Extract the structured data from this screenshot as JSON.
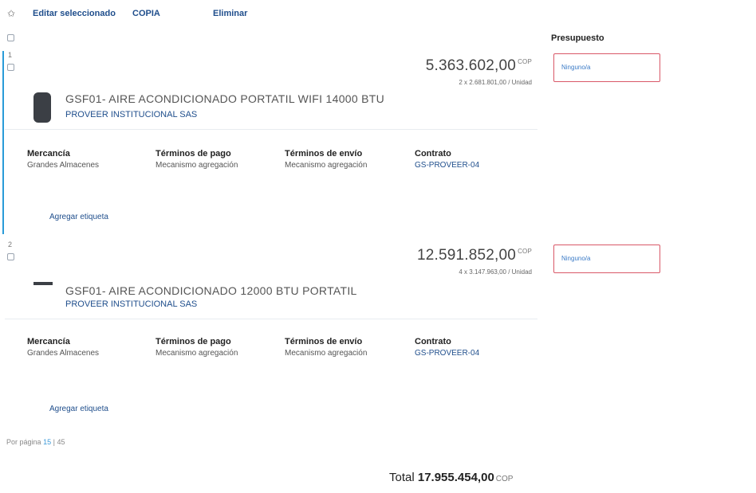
{
  "toolbar": {
    "edit_label": "Editar seleccionado",
    "copy_label": "COPIA",
    "delete_label": "Eliminar"
  },
  "budget_header": "Presupuesto",
  "items": [
    {
      "number": "1",
      "price": "5.363.602,00",
      "currency": "COP",
      "unit_detail": "2 x 2.681.801,00 / Unidad",
      "product_name": "GSF01- AIRE ACONDICIONADO PORTATIL WIFI 14000 BTU",
      "supplier": "PROVEER INSTITUCIONAL SAS",
      "merchandise_label": "Mercancía",
      "merchandise_value": "Grandes Almacenes",
      "payment_label": "Términos de pago",
      "payment_value": "Mecanismo agregación",
      "shipping_label": "Términos de envío",
      "shipping_value": "Mecanismo agregación",
      "contract_label": "Contrato",
      "contract_value": "GS-PROVEER-04",
      "tag_link": "Agregar etiqueta",
      "budget_value": "Ninguno/a"
    },
    {
      "number": "2",
      "price": "12.591.852,00",
      "currency": "COP",
      "unit_detail": "4 x 3.147.963,00 / Unidad",
      "product_name": "GSF01- AIRE ACONDICIONADO 12000 BTU PORTATIL",
      "supplier": "PROVEER INSTITUCIONAL SAS",
      "merchandise_label": "Mercancía",
      "merchandise_value": "Grandes Almacenes",
      "payment_label": "Términos de pago",
      "payment_value": "Mecanismo agregación",
      "shipping_label": "Términos de envío",
      "shipping_value": "Mecanismo agregación",
      "contract_label": "Contrato",
      "contract_value": "GS-PROVEER-04",
      "tag_link": "Agregar etiqueta",
      "budget_value": "Ninguno/a"
    }
  ],
  "pagination": {
    "label": "Por página",
    "current": "15",
    "separator": "|",
    "other": "45"
  },
  "total": {
    "label": "Total",
    "value": "17.955.454,00",
    "currency": "COP"
  },
  "colors": {
    "accent_blue": "#2a9bd8",
    "link_blue": "#1f4e8c",
    "budget_border": "#d95868"
  },
  "icons": {
    "toolbar": "wand-icon",
    "checkbox": "checkbox-icon"
  }
}
